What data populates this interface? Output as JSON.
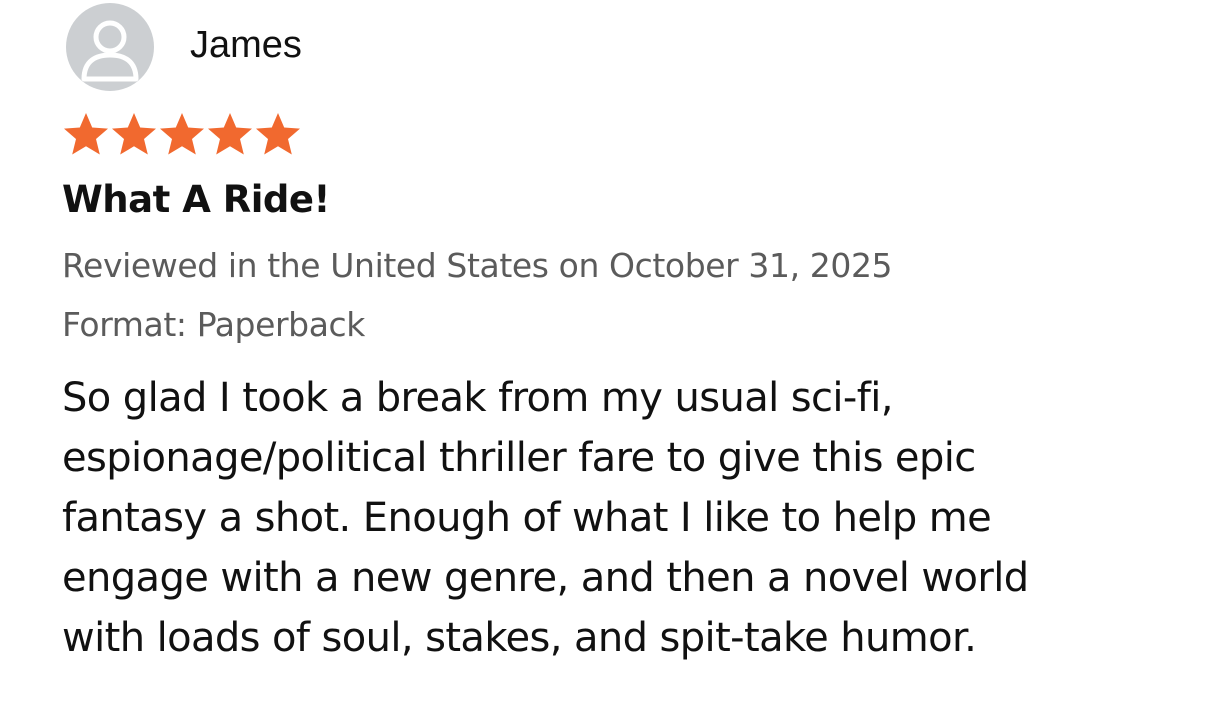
{
  "reviewer": {
    "name": "James",
    "avatar_icon": "person-silhouette-icon"
  },
  "rating": {
    "stars_filled": 5,
    "stars_total": 5,
    "star_color": "#f1692f"
  },
  "review": {
    "title": "What A Ride!",
    "date_line": "Reviewed in the United States on October 31, 2025",
    "format_line": "Format: Paperback",
    "body_lines": [
      "So glad I took a break from my usual sci-fi,",
      "espionage/political thriller fare to give this epic",
      "fantasy a shot. Enough of what I like to help me",
      "engage with a new genre, and then a novel world",
      "with loads of soul, stakes, and spit-take humor."
    ]
  },
  "colors": {
    "text_primary": "#111111",
    "text_secondary": "#5b5b5b",
    "avatar_background": "#cccfd2",
    "avatar_figure": "#ffffff"
  }
}
